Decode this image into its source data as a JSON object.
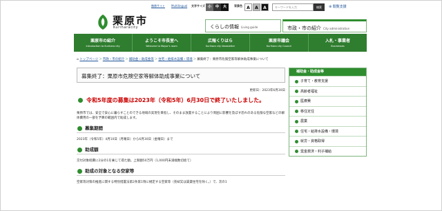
{
  "header": {
    "links": [
      "携帯サイト",
      "Multilingual"
    ],
    "font_size_label": "文字サイズ",
    "font_sizes": [
      "小",
      "中",
      "大"
    ],
    "bg_label": "背景色",
    "bg_options": [
      "A",
      "A",
      "A"
    ],
    "search_placeholder": "キーワードを入力",
    "search_button": "検索",
    "tool_label": "閲覧支援"
  },
  "logo": {
    "ja": "栗原市",
    "en": "Kuriharacity"
  },
  "tabs": [
    {
      "label": "くらしの情報",
      "sub": "Living guide"
    },
    {
      "label": "市政・市の紹介",
      "sub": "City administration"
    }
  ],
  "nav": [
    {
      "ja": "栗原市の紹介",
      "en": "Introduction to Kurihara city"
    },
    {
      "ja": "ようこそ市長室へ",
      "en": "Welcome to Mayor's room"
    },
    {
      "ja": "広報くりはら",
      "en": "Kurihara city Newsletter"
    },
    {
      "ja": "栗原市議会",
      "en": "Kurihara city Council"
    },
    {
      "ja": "入札・事業者",
      "en": "Businesses"
    }
  ],
  "breadcrumb": {
    "items": [
      "トップページ",
      "市政・市の紹介",
      "補助金・助成金等",
      "住宅・給排水設備・環境"
    ],
    "current": "募集終了：栗原市危険空家等解体助成事業について"
  },
  "main": {
    "title": "募集終了：栗原市危険空家等解体助成事業について",
    "updated": "更新日：2023年6月30日",
    "alert": "令和5年度の募集は2023年（令和5年）6月30日で終了いたしました。",
    "intro": "栗原市では、安全で安心に暮らすことのできる地域の実現を目指し、そのまま放置することにより周囲に影響を及ぼす恐れのある危険な空家などの解体費用の一部を予算の範囲内で助成します。",
    "sections": [
      {
        "heading": "募集期間",
        "body": "2023年（令和5年）4月10日（月曜日）から6月30日（金曜日）まで"
      },
      {
        "heading": "助成額",
        "body": "交付対象経費に2分の1を乗じて得た額。上限額50万円（1,000円未満端数切捨て）"
      },
      {
        "heading": "助成の対象となる空家等",
        "body": "空家等対策の推進に関する特別措置法第2条第1項に規定する空家等（売却又は賃貸住宅を除く。）で、次の1"
      }
    ]
  },
  "side": {
    "header": "補助金・助成金等",
    "items": [
      "子育て・教育支援",
      "高齢者福祉",
      "医療費",
      "移住定住",
      "農業",
      "住宅・給排水設備・環境",
      "就労・資格取得",
      "奨金救済・利子補給"
    ]
  }
}
